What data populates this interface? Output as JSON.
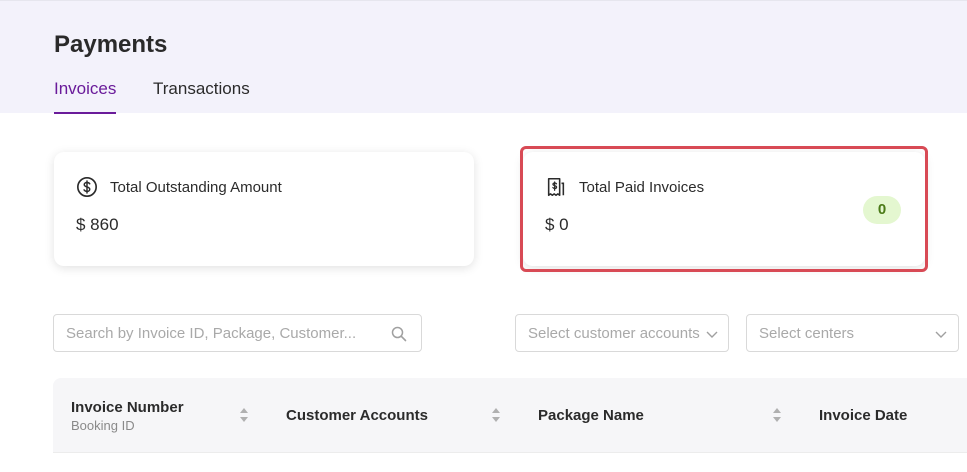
{
  "header": {
    "title": "Payments",
    "tabs": [
      {
        "label": "Invoices",
        "active": true
      },
      {
        "label": "Transactions",
        "active": false
      }
    ]
  },
  "cards": {
    "outstanding": {
      "label": "Total Outstanding Amount",
      "value": "$ 860",
      "icon": "dollar-circle-icon"
    },
    "paid": {
      "label": "Total Paid Invoices",
      "value": "$ 0",
      "badge": "0",
      "icon": "receipt-dollar-icon"
    }
  },
  "filters": {
    "search_placeholder": "Search by Invoice ID, Package, Customer...",
    "accounts_placeholder": "Select customer accounts",
    "centers_placeholder": "Select centers"
  },
  "table": {
    "columns": [
      {
        "label": "Invoice Number",
        "sub": "Booking ID"
      },
      {
        "label": "Customer Accounts"
      },
      {
        "label": "Package Name"
      },
      {
        "label": "Invoice Date"
      }
    ]
  },
  "colors": {
    "accent": "#6a1b9a",
    "highlight": "#d84a55",
    "header_bg": "#f3f2fb",
    "badge_bg": "#e4f7d0"
  }
}
